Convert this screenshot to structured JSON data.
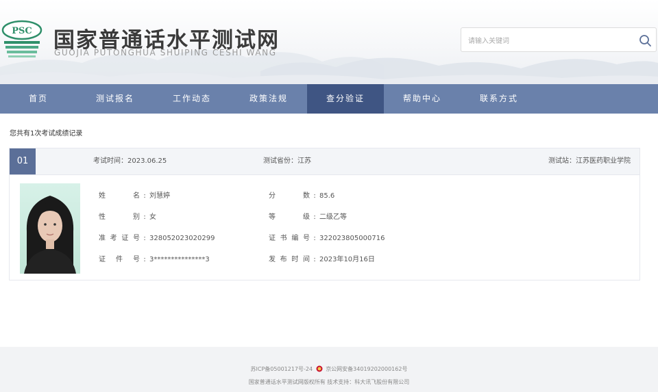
{
  "header": {
    "logo_text": "PSC",
    "title": "国家普通话水平测试网",
    "subtitle": "GUOJIA PUTONGHUA SHUIPING CESHI WANG",
    "search_placeholder": "请输入关键词"
  },
  "nav": {
    "items": [
      {
        "label": "首页"
      },
      {
        "label": "测试报名"
      },
      {
        "label": "工作动态"
      },
      {
        "label": "政策法规"
      },
      {
        "label": "查分验证"
      },
      {
        "label": "帮助中心"
      },
      {
        "label": "联系方式"
      }
    ],
    "active_index": 4
  },
  "summary": "您共有1次考试成绩记录",
  "record": {
    "number": "01",
    "exam_time_label": "考试时间：",
    "exam_time": "2023.06.25",
    "province_label": "测试省份：",
    "province": "江苏",
    "station_label": "测试站：",
    "station": "江苏医药职业学院",
    "fields": {
      "name_label": "姓　名",
      "name": "刘慧婷",
      "gender_label": "性　别",
      "gender": "女",
      "ticket_label": "准考证号",
      "ticket": "328052023020299",
      "id_label": "证件号",
      "id": "3***************3",
      "score_label": "分　数",
      "score": "85.6",
      "level_label": "等　级",
      "level": "二级乙等",
      "cert_label": "证书编号",
      "cert": "32202380500071​6",
      "date_label": "发布时间",
      "date": "2023年10月16日"
    }
  },
  "footer": {
    "icp": "苏ICP备05001217号-24",
    "police": "京公网安备34019202000162号",
    "copyright": "国家普通话水平测试网版权所有 技术支持：科大讯飞股份有限公司"
  },
  "colors": {
    "nav_bg": "#6a81ab",
    "nav_active": "#3f5583",
    "badge": "#5b6f98"
  }
}
